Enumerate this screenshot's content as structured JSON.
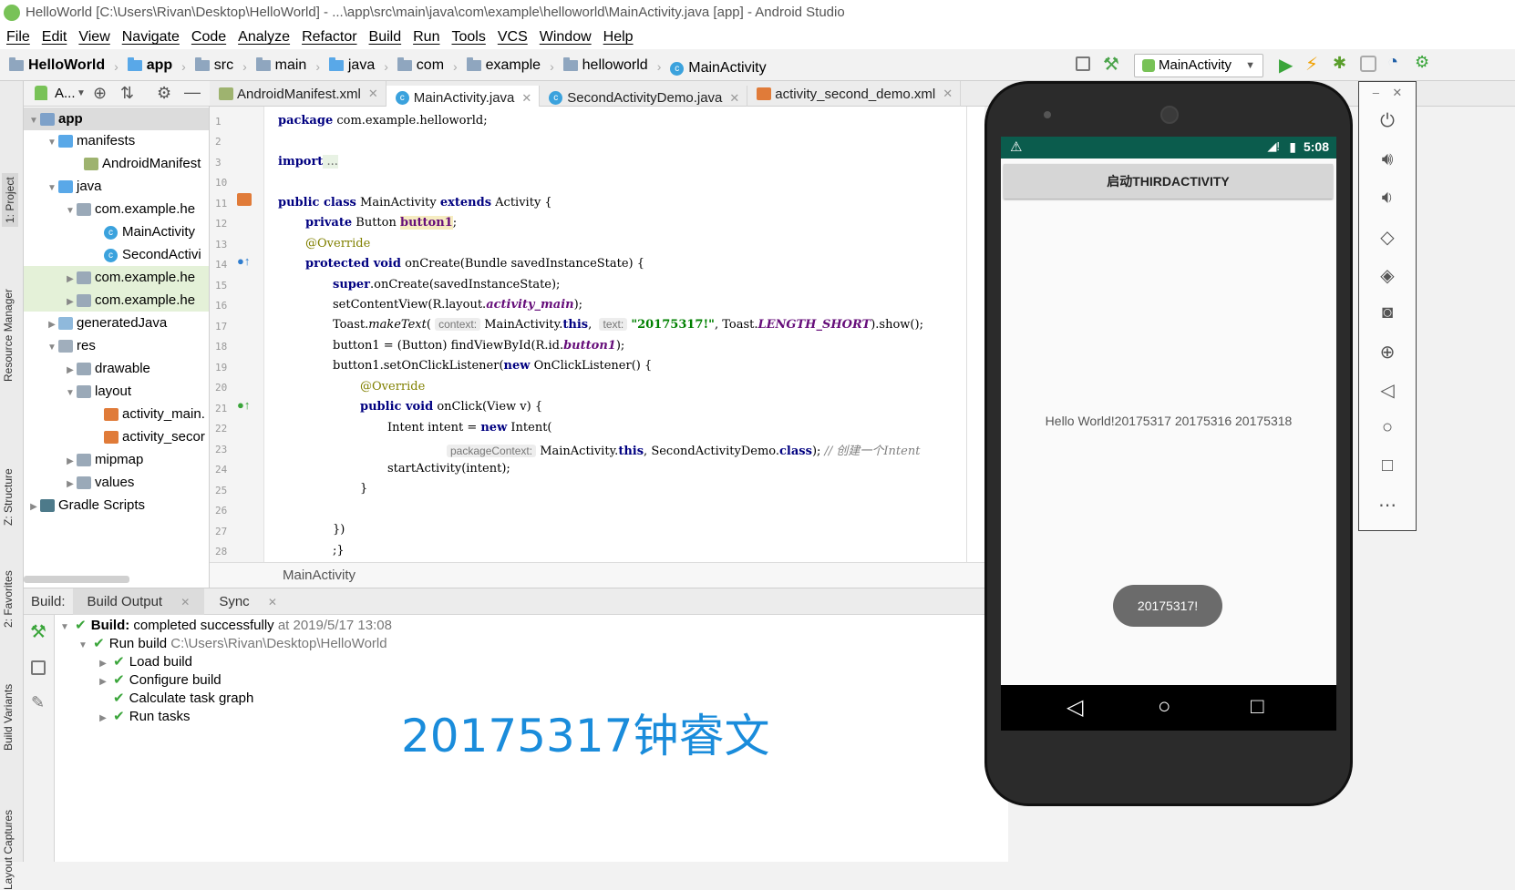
{
  "window": {
    "title": "HelloWorld [C:\\Users\\Rivan\\Desktop\\HelloWorld] - ...\\app\\src\\main\\java\\com\\example\\helloworld\\MainActivity.java [app] - Android Studio"
  },
  "menu": [
    "File",
    "Edit",
    "View",
    "Navigate",
    "Code",
    "Analyze",
    "Refactor",
    "Build",
    "Run",
    "Tools",
    "VCS",
    "Window",
    "Help"
  ],
  "breadcrumb": [
    "HelloWorld",
    "app",
    "src",
    "main",
    "java",
    "com",
    "example",
    "helloworld",
    "MainActivity"
  ],
  "run_config": "MainActivity",
  "project_panel": {
    "title": "A...",
    "tree": [
      {
        "label": "app",
        "bold": true
      },
      {
        "label": "manifests"
      },
      {
        "label": "AndroidManifest"
      },
      {
        "label": "java"
      },
      {
        "label": "com.example.he"
      },
      {
        "label": "MainActivity"
      },
      {
        "label": "SecondActivi"
      },
      {
        "label": "com.example.he"
      },
      {
        "label": "com.example.he"
      },
      {
        "label": "generatedJava"
      },
      {
        "label": "res"
      },
      {
        "label": "drawable"
      },
      {
        "label": "layout"
      },
      {
        "label": "activity_main."
      },
      {
        "label": "activity_secor"
      },
      {
        "label": "mipmap"
      },
      {
        "label": "values"
      },
      {
        "label": "Gradle Scripts"
      }
    ]
  },
  "side_tabs": [
    "1: Project",
    "Resource Manager",
    "Z: Structure",
    "2: Favorites",
    "Build Variants",
    "Layout Captures"
  ],
  "editor_tabs": [
    "AndroidManifest.xml",
    "MainActivity.java",
    "SecondActivityDemo.java",
    "activity_second_demo.xml"
  ],
  "line_numbers": [
    "1",
    "2",
    "3",
    "10",
    "11",
    "12",
    "13",
    "14",
    "15",
    "16",
    "17",
    "18",
    "19",
    "20",
    "21",
    "22",
    "23",
    "24",
    "25",
    "26",
    "27",
    "28"
  ],
  "code": {
    "l1_kw": "package",
    "l1": " com.example.helloworld;",
    "l3_kw": "import",
    "l3": " ...",
    "l11_a": "public class",
    "l11_b": " MainActivity ",
    "l11_c": "extends",
    "l11_d": " Activity {",
    "l12_a": "private",
    "l12_b": " Button ",
    "l12_c": "button1",
    ";": ";",
    "l13": "@Override",
    "l14_a": "protected void",
    "l14_b": " onCreate(Bundle savedInstanceState) {",
    "l15_a": "super",
    "l15_b": ".onCreate(savedInstanceState);",
    "l16_a": "setContentView(R.layout.",
    "l16_b": "activity_main",
    "l16_c": ");",
    "l17_a": "Toast.",
    "l17_b": "makeText",
    "l17_c": "(",
    "l17_h1": "context:",
    "l17_d": " MainActivity.",
    "l17_e": "this",
    ",": ",",
    "l17_h2": "text:",
    "l17_f": "\"20175317!\"",
    "l17_g": ", Toast.",
    "l17_i": "LENGTH_SHORT",
    "l17_j": ").show();",
    "l18_a": "button1 = (Button) findViewById(R.id.",
    "l18_b": "button1",
    "l18_c": ");",
    "l19_a": "button1.setOnClickListener(",
    "l19_b": "new",
    "l19_c": " OnClickListener() {",
    "l20": "@Override",
    "l21_a": "public void",
    "l21_b": " onClick(View v) {",
    "l22_a": "Intent intent = ",
    "l22_b": "new",
    "l22_c": " Intent(",
    "l23_h": "packageContext:",
    "l23_a": " MainActivity.",
    "l23_b": "this",
    "l23_c": " SecondActivityDemo.",
    "l23_d": "class",
    "l23_e": ");",
    "l23_f": " // 创建一个Intent",
    "l24": "startActivity(intent);",
    "l25": "}",
    "l27": "})",
    "l28": ";}"
  },
  "editor_breadcrumb": "MainActivity",
  "build": {
    "label": "Build:",
    "tabs": [
      "Build Output",
      "Sync"
    ],
    "rows": [
      {
        "bold": "Build:",
        "text": " completed successfully",
        "meta": " at 2019/5/17 13:08"
      },
      {
        "text": "Run build",
        "meta": " C:\\Users\\Rivan\\Desktop\\HelloWorld"
      },
      {
        "text": "Load build"
      },
      {
        "text": "Configure build"
      },
      {
        "text": "Calculate task graph"
      },
      {
        "text": "Run tasks"
      }
    ]
  },
  "watermark": "20175317钟睿文",
  "emulator": {
    "time": "5:08",
    "button_label": "启动THIRDACTIVITY",
    "hello_text": "Hello World!20175317 20175316 20175318",
    "toast": "20175317!"
  }
}
